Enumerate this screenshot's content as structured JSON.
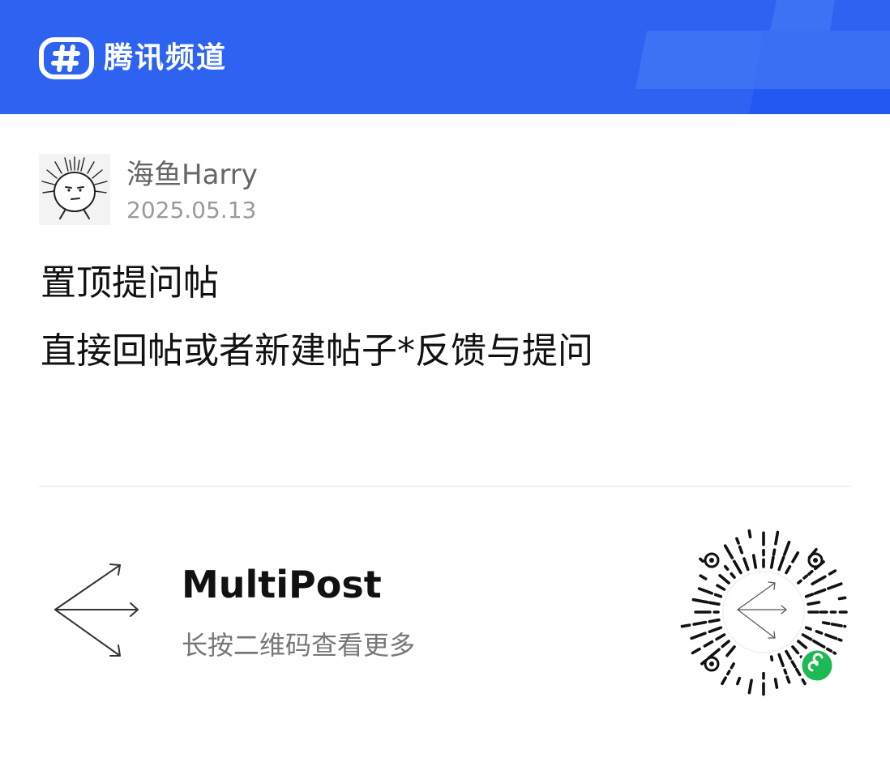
{
  "header": {
    "brand_name": "腾讯频道",
    "background_color": "#2d63f0",
    "logo_icon": "tencent-channel-logo-icon"
  },
  "post": {
    "author_name": "海鱼Harry",
    "date": "2025.05.13",
    "title": "置顶提问帖",
    "body": "直接回帖或者新建帖子*反馈与提问"
  },
  "footer": {
    "app_name": "MultiPost",
    "hint": "长按二维码查看更多",
    "app_icon": "multipost-arrows-icon",
    "qr_code_icon": "mini-program-qr-code-icon",
    "qr_badge_color": "#1db954"
  }
}
